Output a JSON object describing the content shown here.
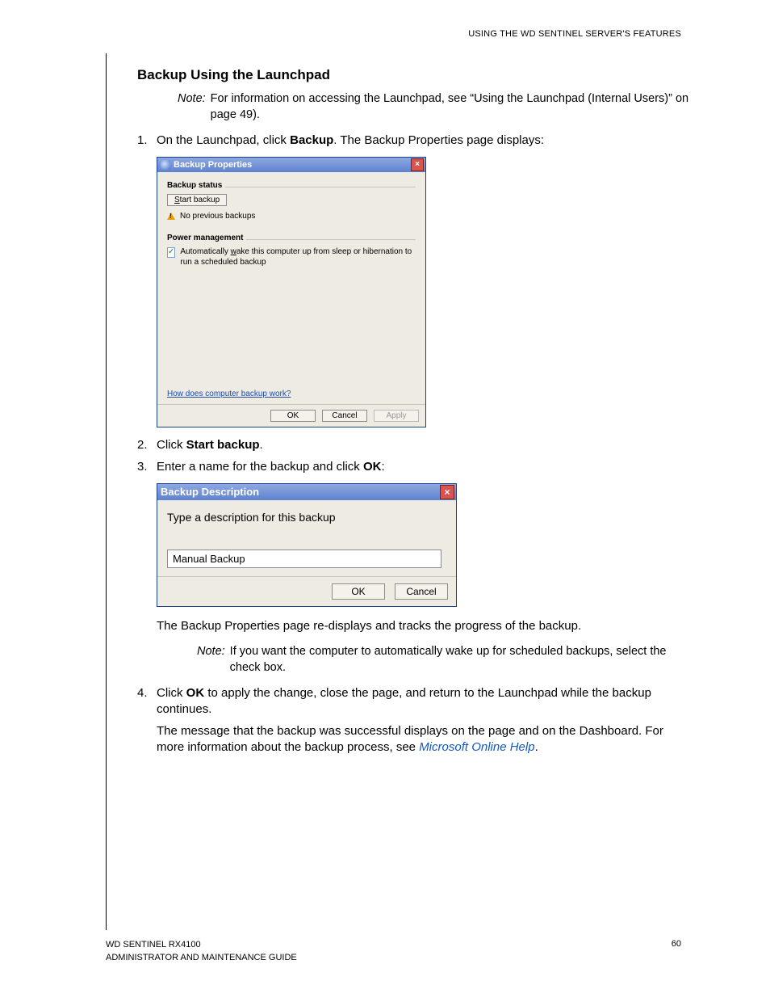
{
  "header": {
    "right": "USING THE WD SENTINEL SERVER'S FEATURES"
  },
  "heading": "Backup Using the Launchpad",
  "note1": {
    "label": "Note:",
    "text": "For information on accessing the Launchpad, see “Using the Launchpad (Internal Users)” on page 49)."
  },
  "steps": {
    "s1": {
      "num": "1.",
      "pre": "On the Launchpad, click ",
      "bold": "Backup",
      "post": ". The Backup Properties page displays:"
    },
    "s2": {
      "num": "2.",
      "pre": "Click ",
      "bold": "Start backup",
      "post": "."
    },
    "s3": {
      "num": "3.",
      "pre": "Enter a name for the backup and click ",
      "bold": "OK",
      "post": ":"
    },
    "s3b": "The Backup Properties page re-displays and tracks the progress of the backup.",
    "s4": {
      "num": "4.",
      "pre": "Click ",
      "bold": "OK",
      "post": " to apply the change, close the page, and return to the Launchpad while the backup continues.",
      "p2": "The message that the backup was successful displays on the page and on the Dashboard. For more information about the backup process, see ",
      "link": "Microsoft Online Help",
      "p2end": "."
    }
  },
  "note2": {
    "label": "Note:",
    "text": "If you want the computer to automatically wake up for scheduled backups, select the check box."
  },
  "dialog1": {
    "title": "Backup Properties",
    "status_label": "Backup status",
    "start_btn": "Start backup",
    "no_prev": "No previous backups",
    "power_label": "Power management",
    "checkbox_text": "Automatically wake this computer up from sleep or hibernation to run a scheduled backup",
    "help_link": "How does computer backup work?",
    "ok": "OK",
    "cancel": "Cancel",
    "apply": "Apply"
  },
  "dialog2": {
    "title": "Backup Description",
    "heading": "Type a description for this backup",
    "input_value": "Manual Backup",
    "ok": "OK",
    "cancel": "Cancel"
  },
  "footer": {
    "line1": "WD SENTINEL RX4100",
    "line2": "ADMINISTRATOR AND MAINTENANCE GUIDE",
    "page": "60"
  }
}
